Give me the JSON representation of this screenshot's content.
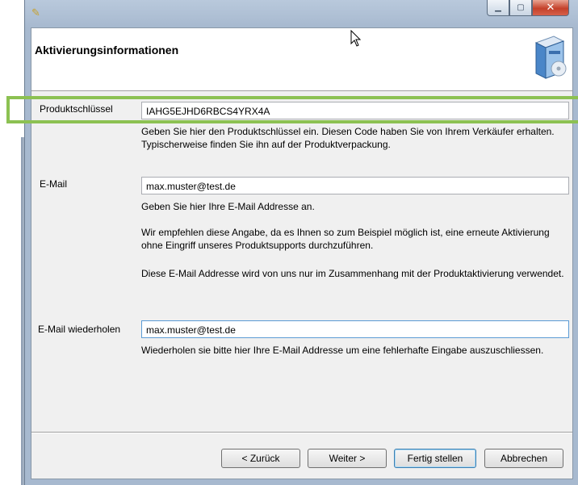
{
  "header": {
    "title": "Aktivierungsinformationen"
  },
  "product_key": {
    "label": "Produktschlüssel",
    "value": "IAHG5EJHD6RBCS4YRX4A",
    "help": "Geben Sie hier den Produktschlüssel ein. Diesen Code haben Sie von Ihrem Verkäufer erhalten. Typischerweise finden Sie ihn auf der Produktverpackung."
  },
  "email": {
    "label": "E-Mail",
    "value": "max.muster@test.de",
    "help1": "Geben Sie hier Ihre E-Mail Addresse an.",
    "help2": "Wir empfehlen diese Angabe, da es Ihnen so zum Beispiel möglich ist, eine erneute Aktivierung ohne Eingriff unseres Produktsupports durchzuführen.",
    "help3": "Diese E-Mail Addresse wird von uns nur im Zusammenhang mit der Produktaktivierung verwendet."
  },
  "email_repeat": {
    "label": "E-Mail wiederholen",
    "value": "max.muster@test.de",
    "help": "Wiederholen sie bitte hier Ihre E-Mail Addresse um eine fehlerhafte Eingabe auszuschliessen."
  },
  "buttons": {
    "back": "< Zurück",
    "next": "Weiter >",
    "finish": "Fertig stellen",
    "cancel": "Abbrechen"
  },
  "colors": {
    "highlight": "#8cc152",
    "focus_border": "#5b9bd5"
  },
  "icons": {
    "app": "quill-icon",
    "header": "software-box-icon"
  }
}
